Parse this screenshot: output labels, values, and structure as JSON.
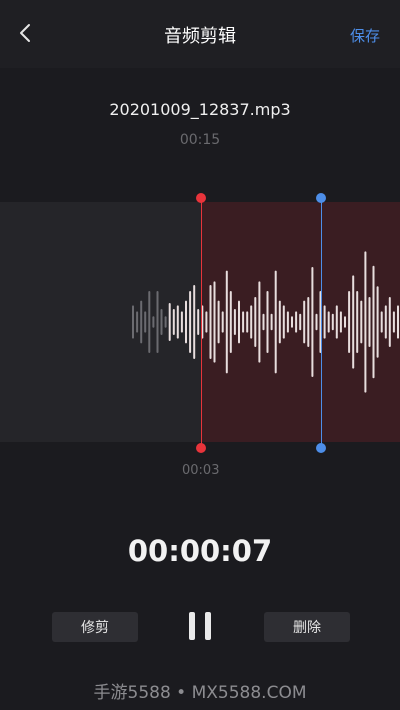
{
  "header": {
    "title": "音频剪辑",
    "save_label": "保存"
  },
  "file": {
    "name": "20201009_12837.mp3",
    "duration": "00:15"
  },
  "trim": {
    "start_label": "00:03",
    "start_color": "#e8343b",
    "end_color": "#4d8ee8",
    "selection_color": "#3a1d22"
  },
  "playback": {
    "current_time": "00:00:07"
  },
  "controls": {
    "trim_label": "修剪",
    "delete_label": "删除"
  },
  "watermark": "手游5588 • MX5588.COM",
  "waveform": {
    "amplitudes": [
      0.13,
      0.08,
      0.17,
      0.08,
      0.25,
      0.04,
      0.25,
      0.1,
      0.04,
      0.15,
      0.1,
      0.13,
      0.08,
      0.17,
      0.25,
      0.3,
      0.1,
      0.13,
      0.08,
      0.3,
      0.33,
      0.17,
      0.08,
      0.42,
      0.25,
      0.1,
      0.17,
      0.08,
      0.08,
      0.13,
      0.2,
      0.33,
      0.06,
      0.25,
      0.06,
      0.42,
      0.17,
      0.13,
      0.08,
      0.04,
      0.08,
      0.06,
      0.17,
      0.2,
      0.45,
      0.06,
      0.25,
      0.13,
      0.08,
      0.06,
      0.13,
      0.08,
      0.04,
      0.25,
      0.38,
      0.25,
      0.17,
      0.58,
      0.2,
      0.46,
      0.29,
      0.08,
      0.13,
      0.2,
      0.08,
      0.13
    ],
    "left_dim_count": 9
  }
}
